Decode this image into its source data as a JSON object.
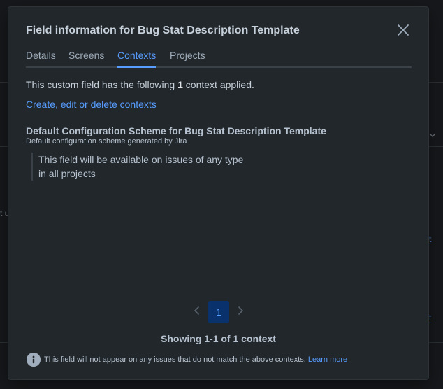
{
  "dialog": {
    "title": "Field information for Bug Stat Description Template",
    "close_icon": "close-icon"
  },
  "tabs": [
    {
      "label": "Details",
      "active": false
    },
    {
      "label": "Screens",
      "active": false
    },
    {
      "label": "Contexts",
      "active": true
    },
    {
      "label": "Projects",
      "active": false
    }
  ],
  "contexts": {
    "summary_prefix": "This custom field has the following ",
    "count": "1",
    "summary_suffix": " context applied.",
    "manage_link": "Create, edit or delete contexts",
    "items": [
      {
        "name": "Default Configuration Scheme for Bug Stat Description Template",
        "description": "Default configuration scheme generated by Jira",
        "issue_types": "This field will be available on issues of any type",
        "projects": "in all projects"
      }
    ]
  },
  "pagination": {
    "current_page": "1",
    "prev_icon": "chevron-left-icon",
    "next_icon": "chevron-right-icon",
    "showing": "Showing 1-1 of 1 context"
  },
  "footer": {
    "info_icon": "info-icon",
    "note": "This field will not appear on any issues that do not match the above contexts.",
    "learn_more": "Learn more"
  },
  "background": {
    "fragment_1": "t u",
    "fragment_2": "t",
    "fragment_3": "t"
  },
  "colors": {
    "modal_bg": "#22272b",
    "accent": "#579dff",
    "text": "#b6c2cf"
  }
}
